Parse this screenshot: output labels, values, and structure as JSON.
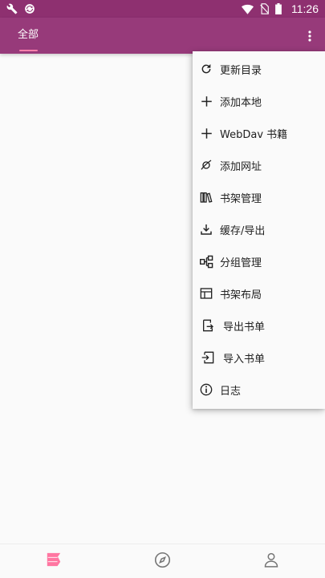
{
  "status_bar": {
    "time": "11:26",
    "left_icons": [
      "wrench-icon",
      "sync-icon"
    ],
    "right_icons": [
      "wifi-icon",
      "no-sim-icon",
      "battery-icon"
    ]
  },
  "app_bar": {
    "tab_label": "全部",
    "accent_color": "#973a7a",
    "indicator_color": "#ff80ab"
  },
  "menu": {
    "items": [
      {
        "label": "更新目录",
        "icon": "refresh-icon"
      },
      {
        "label": "添加本地",
        "icon": "plus-icon"
      },
      {
        "label": "WebDav 书籍",
        "icon": "plus-icon"
      },
      {
        "label": "添加网址",
        "icon": "planet-icon"
      },
      {
        "label": "书架管理",
        "icon": "bookshelf-icon"
      },
      {
        "label": "缓存/导出",
        "icon": "download-icon"
      },
      {
        "label": "分组管理",
        "icon": "group-icon"
      },
      {
        "label": "书架布局",
        "icon": "layout-icon"
      },
      {
        "label": "导出书单",
        "icon": "export-icon"
      },
      {
        "label": "导入书单",
        "icon": "import-icon"
      },
      {
        "label": "日志",
        "icon": "info-icon"
      }
    ]
  },
  "bottom_nav": {
    "items": [
      {
        "name": "bookshelf",
        "icon": "bookshelf-nav-icon",
        "active": true
      },
      {
        "name": "discover",
        "icon": "compass-icon",
        "active": false
      },
      {
        "name": "profile",
        "icon": "person-icon",
        "active": false
      }
    ],
    "active_color": "#ff6f9c",
    "inactive_color": "#757575"
  }
}
